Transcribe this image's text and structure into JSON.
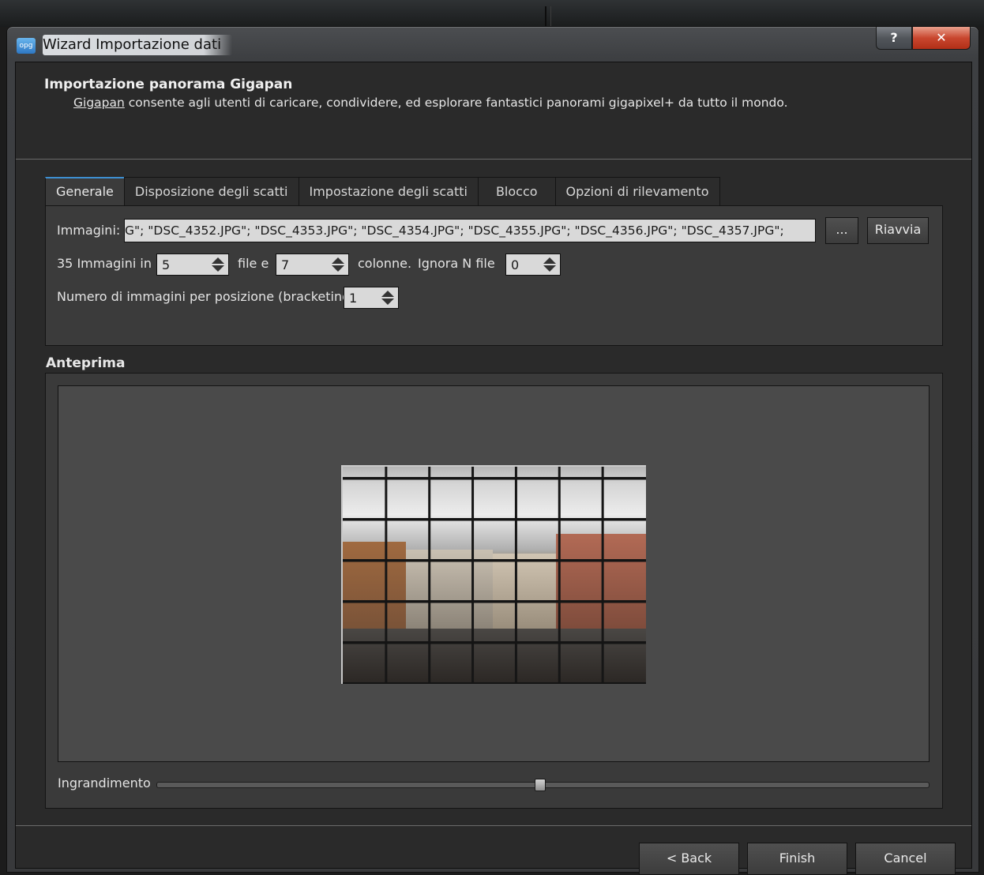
{
  "window": {
    "title": "Wizard Importazione dati",
    "app_icon_text": "opg",
    "help_label": "?",
    "close_label": "✕"
  },
  "header": {
    "title": "Importazione panorama Gigapan",
    "link_text": "Gigapan",
    "subtitle": " consente agli utenti di caricare, condividere, ed esplorare fantastici panorami gigapixel+ da tutto il mondo."
  },
  "tabs": [
    {
      "label": "Generale",
      "active": true
    },
    {
      "label": "Disposizione degli scatti",
      "active": false
    },
    {
      "label": "Impostazione degli scatti",
      "active": false
    },
    {
      "label": "Blocco",
      "active": false
    },
    {
      "label": "Opzioni di rilevamento",
      "active": false
    }
  ],
  "general": {
    "images_label": "Immagini:",
    "images_value": "G\"; \"DSC_4352.JPG\"; \"DSC_4353.JPG\"; \"DSC_4354.JPG\"; \"DSC_4355.JPG\"; \"DSC_4356.JPG\"; \"DSC_4357.JPG\";",
    "browse_label": "...",
    "reset_label": "Riavvia",
    "count_prefix": "35 Immagini in",
    "rows_value": "5",
    "rows_suffix": "file e",
    "cols_value": "7",
    "cols_suffix": "colonne.",
    "ignore_label": "Ignora N file",
    "ignore_value": "0",
    "bracket_label": "Numero di immagini per posizione (bracketing)",
    "bracket_value": "1"
  },
  "preview": {
    "title": "Anteprima",
    "zoom_label": "Ingrandimento",
    "zoom_fraction": 0.495,
    "grid_rows": 5,
    "grid_cols": 7
  },
  "footer": {
    "back_label": "< Back",
    "finish_label": "Finish",
    "cancel_label": "Cancel"
  },
  "colors": {
    "accent": "#3d8fd1",
    "close_button": "#c9472f"
  }
}
